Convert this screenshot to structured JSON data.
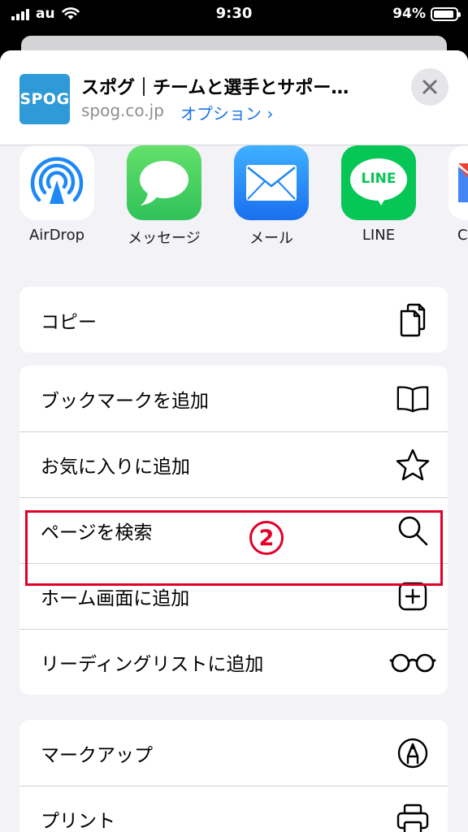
{
  "status_bar": {
    "carrier": "au",
    "time": "9:30",
    "battery_percent": "94%",
    "battery_level": 0.94
  },
  "share_header": {
    "site_icon_text": "SPOG",
    "title": "スポグ｜チームと選手とサポー…",
    "domain": "spog.co.jp",
    "options": "オプション ›"
  },
  "apps": [
    {
      "label": "AirDrop",
      "icon": "airdrop-icon"
    },
    {
      "label": "メッセージ",
      "icon": "messages-icon"
    },
    {
      "label": "メール",
      "icon": "mail-icon"
    },
    {
      "label": "LINE",
      "icon": "line-icon",
      "icon_text": "LINE"
    },
    {
      "label": "C",
      "icon": "gmail-icon"
    }
  ],
  "groups": [
    [
      {
        "label": "コピー",
        "icon": "copy-icon"
      }
    ],
    [
      {
        "label": "ブックマークを追加",
        "icon": "book-icon"
      },
      {
        "label": "お気に入りに追加",
        "icon": "star-icon"
      },
      {
        "label": "ページを検索",
        "icon": "search-icon"
      },
      {
        "label": "ホーム画面に追加",
        "icon": "add-square-icon"
      },
      {
        "label": "リーディングリストに追加",
        "icon": "glasses-icon"
      }
    ],
    [
      {
        "label": "マークアップ",
        "icon": "markup-icon"
      },
      {
        "label": "プリント",
        "icon": "printer-icon"
      }
    ]
  ],
  "annotation": {
    "step_number": "2",
    "color": "#e0002a"
  },
  "colors": {
    "link_blue": "#1a73e8",
    "sheet_bg": "#f2f2f7",
    "messages_green": "#34c759",
    "line_green": "#06c755",
    "mail_blue": "#1e88f5"
  }
}
